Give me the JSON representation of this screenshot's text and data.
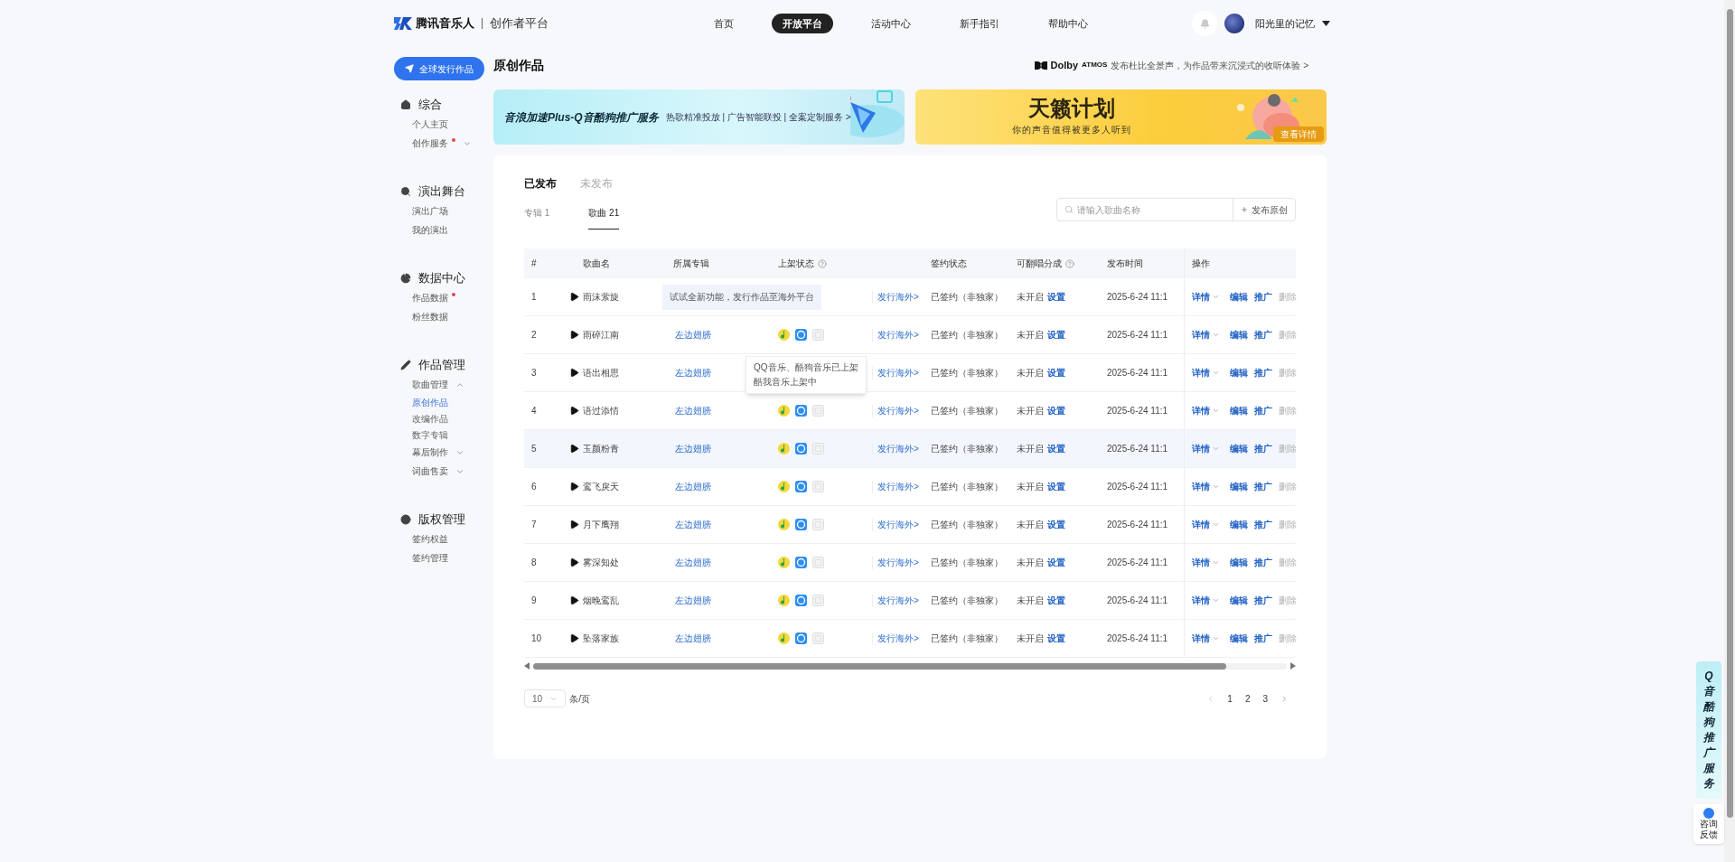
{
  "header": {
    "brand": "腾讯音乐人",
    "subtitle": "创作者平台",
    "nav": [
      {
        "label": "首页",
        "selected": false
      },
      {
        "label": "开放平台",
        "selected": true
      },
      {
        "label": "活动中心",
        "selected": false
      },
      {
        "label": "新手指引",
        "selected": false
      },
      {
        "label": "帮助中心",
        "selected": false
      }
    ],
    "user": "阳光里的记忆"
  },
  "sidebar": {
    "publish_button": "全球发行作品",
    "sections": [
      {
        "title": "综合",
        "items": [
          {
            "label": "个人主页",
            "selected": false,
            "dot": false
          },
          {
            "label": "创作服务",
            "selected": false,
            "dot": true,
            "expanded": false
          }
        ]
      },
      {
        "title": "演出舞台",
        "items": [
          {
            "label": "演出广场",
            "selected": false,
            "dot": false
          },
          {
            "label": "我的演出",
            "selected": false,
            "dot": false
          }
        ]
      },
      {
        "title": "数据中心",
        "items": [
          {
            "label": "作品数据",
            "selected": false,
            "dot": true
          },
          {
            "label": "粉丝数据",
            "selected": false,
            "dot": false
          }
        ]
      },
      {
        "title": "作品管理",
        "items": [
          {
            "label": "歌曲管理",
            "selected": false,
            "dot": false,
            "expanded": true,
            "children": [
              {
                "label": "原创作品",
                "selected": true
              },
              {
                "label": "改编作品",
                "selected": false
              },
              {
                "label": "数字专辑",
                "selected": false
              }
            ]
          },
          {
            "label": "幕后制作",
            "selected": false,
            "dot": false,
            "expanded": false
          },
          {
            "label": "词曲售卖",
            "selected": false,
            "dot": false,
            "expanded": false
          }
        ]
      },
      {
        "title": "版权管理",
        "items": [
          {
            "label": "签约权益",
            "selected": false,
            "dot": false
          },
          {
            "label": "签约管理",
            "selected": false,
            "dot": false
          }
        ]
      }
    ]
  },
  "page": {
    "title": "原创作品",
    "dolby": {
      "brand": "Dolby",
      "tag": "ATMOS",
      "text": "发布杜比全景声，为作品带来沉浸式的收听体验 >"
    }
  },
  "banners": [
    {
      "title": "音浪加速Plus-Q音酷狗推广服务",
      "subtitle": "热歌精准投放 | 广告智能联投 | 全案定制服务 >"
    },
    {
      "title": "天籁计划",
      "subtitle": "你的声音值得被更多人听到",
      "button": "查看详情"
    }
  ],
  "tabs": [
    {
      "label": "已发布",
      "selected": true
    },
    {
      "label": "未发布",
      "selected": false
    }
  ],
  "subtabs": [
    {
      "label": "专辑 1",
      "selected": false
    },
    {
      "label": "歌曲 21",
      "selected": true
    }
  ],
  "search": {
    "placeholder": "请输入歌曲名称"
  },
  "publish_original": "发布原创",
  "table": {
    "columns": [
      {
        "label": "#",
        "help": false
      },
      {
        "label": "歌曲名",
        "help": false
      },
      {
        "label": "所属专辑",
        "help": false
      },
      {
        "label": "上架状态",
        "help": true
      },
      {
        "label": "签约状态",
        "help": false
      },
      {
        "label": "可翻唱分成",
        "help": true
      },
      {
        "label": "发布时间",
        "help": false
      },
      {
        "label": "操作",
        "help": false
      }
    ],
    "rows": [
      {
        "no": "1",
        "name": "雨沫萦旋",
        "hovered": false,
        "notice": "试试全新功能，发行作品至海外平台",
        "overseas": "发行海外>",
        "sign": "已签约（非独家）",
        "cover": "未开启",
        "cover_link": "设置",
        "time": "2025-6-24 11:1",
        "actions": [
          {
            "label": "详情",
            "disabled": false
          },
          {
            "label": "编辑",
            "disabled": false
          },
          {
            "label": "推广",
            "disabled": false
          },
          {
            "label": "删除",
            "disabled": true
          }
        ]
      },
      {
        "no": "2",
        "name": "雨碎江南",
        "hovered": false,
        "album": "左边翅膀",
        "platforms": [
          {
            "live": true
          },
          {
            "live": true
          },
          {
            "live": false
          }
        ],
        "overseas": "发行海外>",
        "sign": "已签约（非独家）",
        "cover": "未开启",
        "cover_link": "设置",
        "time": "2025-6-24 11:1",
        "actions": [
          {
            "label": "详情",
            "disabled": false
          },
          {
            "label": "编辑",
            "disabled": false
          },
          {
            "label": "推广",
            "disabled": false
          },
          {
            "label": "删除",
            "disabled": true
          }
        ]
      },
      {
        "no": "3",
        "name": "语出相思",
        "hovered": false,
        "album": "左边翅膀",
        "popover": [
          "QQ音乐、酷狗音乐已上架",
          "酷我音乐上架中"
        ],
        "overseas": "发行海外>",
        "sign": "已签约（非独家）",
        "cover": "未开启",
        "cover_link": "设置",
        "time": "2025-6-24 11:1",
        "actions": [
          {
            "label": "详情",
            "disabled": false
          },
          {
            "label": "编辑",
            "disabled": false
          },
          {
            "label": "推广",
            "disabled": false
          },
          {
            "label": "删除",
            "disabled": true
          }
        ]
      },
      {
        "no": "4",
        "name": "语过添情",
        "hovered": false,
        "album": "左边翅膀",
        "platforms": [
          {
            "live": true
          },
          {
            "live": true
          },
          {
            "live": false
          }
        ],
        "overseas": "发行海外>",
        "sign": "已签约（非独家）",
        "cover": "未开启",
        "cover_link": "设置",
        "time": "2025-6-24 11:1",
        "actions": [
          {
            "label": "详情",
            "disabled": false
          },
          {
            "label": "编辑",
            "disabled": false
          },
          {
            "label": "推广",
            "disabled": false
          },
          {
            "label": "删除",
            "disabled": true
          }
        ]
      },
      {
        "no": "5",
        "name": "玉颜粉青",
        "hovered": true,
        "album": "左边翅膀",
        "platforms": [
          {
            "live": true
          },
          {
            "live": true
          },
          {
            "live": false
          }
        ],
        "overseas": "发行海外>",
        "sign": "已签约（非独家）",
        "cover": "未开启",
        "cover_link": "设置",
        "time": "2025-6-24 11:1",
        "actions": [
          {
            "label": "详情",
            "disabled": false
          },
          {
            "label": "编辑",
            "disabled": false
          },
          {
            "label": "推广",
            "disabled": false
          },
          {
            "label": "删除",
            "disabled": true
          }
        ]
      },
      {
        "no": "6",
        "name": "鸾飞戾天",
        "hovered": false,
        "album": "左边翅膀",
        "platforms": [
          {
            "live": true
          },
          {
            "live": true
          },
          {
            "live": false
          }
        ],
        "overseas": "发行海外>",
        "sign": "已签约（非独家）",
        "cover": "未开启",
        "cover_link": "设置",
        "time": "2025-6-24 11:1",
        "actions": [
          {
            "label": "详情",
            "disabled": false
          },
          {
            "label": "编辑",
            "disabled": false
          },
          {
            "label": "推广",
            "disabled": false
          },
          {
            "label": "删除",
            "disabled": true
          }
        ]
      },
      {
        "no": "7",
        "name": "月下鹰翔",
        "hovered": false,
        "album": "左边翅膀",
        "platforms": [
          {
            "live": true
          },
          {
            "live": true
          },
          {
            "live": false
          }
        ],
        "overseas": "发行海外>",
        "sign": "已签约（非独家）",
        "cover": "未开启",
        "cover_link": "设置",
        "time": "2025-6-24 11:1",
        "actions": [
          {
            "label": "详情",
            "disabled": false
          },
          {
            "label": "编辑",
            "disabled": false
          },
          {
            "label": "推广",
            "disabled": false
          },
          {
            "label": "删除",
            "disabled": true
          }
        ]
      },
      {
        "no": "8",
        "name": "雾深知处",
        "hovered": false,
        "album": "左边翅膀",
        "platforms": [
          {
            "live": true
          },
          {
            "live": true
          },
          {
            "live": false
          }
        ],
        "overseas": "发行海外>",
        "sign": "已签约（非独家）",
        "cover": "未开启",
        "cover_link": "设置",
        "time": "2025-6-24 11:1",
        "actions": [
          {
            "label": "详情",
            "disabled": false
          },
          {
            "label": "编辑",
            "disabled": false
          },
          {
            "label": "推广",
            "disabled": false
          },
          {
            "label": "删除",
            "disabled": true
          }
        ]
      },
      {
        "no": "9",
        "name": "烟晚鸾乱",
        "hovered": false,
        "album": "左边翅膀",
        "platforms": [
          {
            "live": true
          },
          {
            "live": true
          },
          {
            "live": false
          }
        ],
        "overseas": "发行海外>",
        "sign": "已签约（非独家）",
        "cover": "未开启",
        "cover_link": "设置",
        "time": "2025-6-24 11:1",
        "actions": [
          {
            "label": "详情",
            "disabled": false
          },
          {
            "label": "编辑",
            "disabled": false
          },
          {
            "label": "推广",
            "disabled": false
          },
          {
            "label": "删除",
            "disabled": true
          }
        ]
      },
      {
        "no": "10",
        "name": "坠落家族",
        "hovered": false,
        "album": "左边翅膀",
        "platforms": [
          {
            "live": true
          },
          {
            "live": true
          },
          {
            "live": false
          }
        ],
        "overseas": "发行海外>",
        "sign": "已签约（非独家）",
        "cover": "未开启",
        "cover_link": "设置",
        "time": "2025-6-24 11:1",
        "actions": [
          {
            "label": "详情",
            "disabled": false
          },
          {
            "label": "编辑",
            "disabled": false
          },
          {
            "label": "推广",
            "disabled": false
          },
          {
            "label": "删除",
            "disabled": true
          }
        ]
      }
    ]
  },
  "pagination": {
    "page_size": "10",
    "unit": "条/页",
    "pages": [
      "1",
      "2",
      "3"
    ]
  },
  "float": {
    "promo": "Q音酷狗推广服务",
    "feedback": "咨询反馈"
  }
}
